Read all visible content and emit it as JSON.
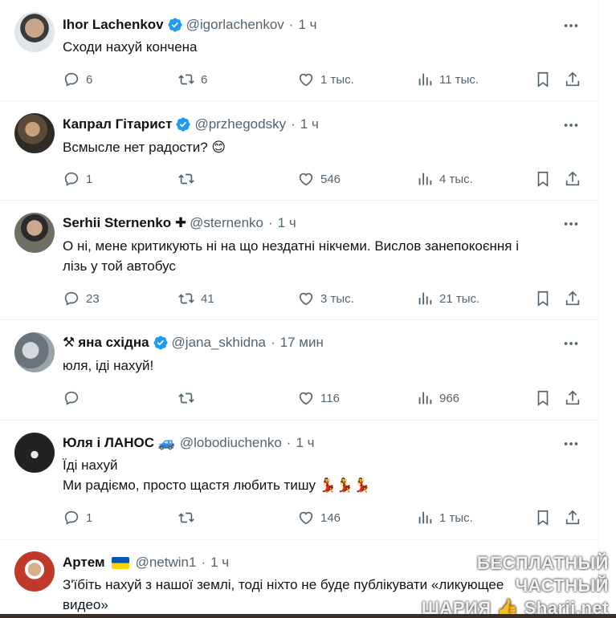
{
  "tweets": [
    {
      "name": "Ihor Lachenkov",
      "handle": "@igorlachenkov",
      "time": "1 ч",
      "text": [
        "Сходи нахуй кончена"
      ],
      "replies": "6",
      "retweets": "6",
      "likes": "1 тыс.",
      "views": "11 тыс."
    },
    {
      "name": "Капрал Гітарист",
      "handle": "@przhegodsky",
      "time": "1 ч",
      "text": [
        "Всмысле нет радости? 😊"
      ],
      "replies": "1",
      "retweets": "",
      "likes": "546",
      "views": "4 тыс."
    },
    {
      "name": "Serhii Sternenko ✚",
      "handle": "@sternenko",
      "time": "1 ч",
      "text": [
        "О ні, мене критикують ні на що нездатні нікчеми. Вислов занепокоєння і",
        "лізь у той автобус"
      ],
      "replies": "23",
      "retweets": "41",
      "likes": "3 тыс.",
      "views": "21 тыс."
    },
    {
      "name_prefix": "⚒",
      "name": "яна східна",
      "handle": "@jana_skhidna",
      "time": "17 мин",
      "text": [
        "юля, іді нахуй!"
      ],
      "replies": "",
      "retweets": "",
      "likes": "116",
      "views": "966"
    },
    {
      "name": "Юля і ЛАНОС 🚙",
      "handle": "@lobodiuchenko",
      "time": "1 ч",
      "text": [
        "Їді нахуй",
        "Ми радіємо, просто щастя любить тишу 💃💃💃"
      ],
      "replies": "1",
      "retweets": "",
      "likes": "146",
      "views": "1 тыс."
    },
    {
      "name": "Артем",
      "name_suffix_flag": "ukraine",
      "handle": "@netwin1",
      "time": "1 ч",
      "text": [
        "З'їбіть нахуй з нашої землі, тоді ніхто не буде публікувати «ликующее",
        "видео»"
      ]
    }
  ],
  "watermark": {
    "line1": "БЕСПЛАТНЫЙ ЧАСТНЫЙ",
    "line2": "ШАРИЯ 👍 Sharij.net"
  },
  "colors": {
    "verified": "#1d9bf0",
    "muted": "#536471",
    "divider": "#eff3f4"
  }
}
